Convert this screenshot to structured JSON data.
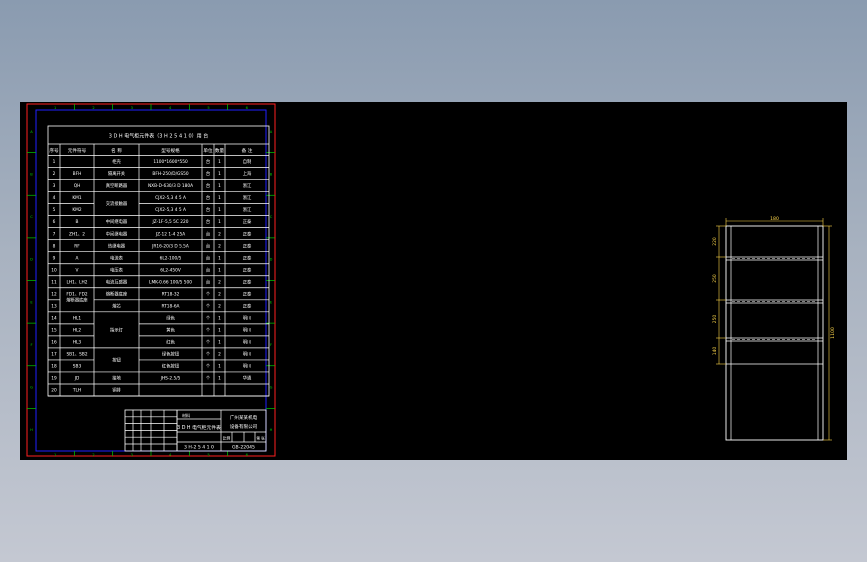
{
  "sheet": {
    "table_title": "3 D H 电气柜元件表（3 H 2 5 4 1 0）用 台",
    "headers": [
      "序号",
      "元件符号",
      "名  称",
      "型号规格",
      "单位",
      "数量",
      "备  注"
    ],
    "rows": [
      {
        "no": "1",
        "sym": "",
        "name": "柜壳",
        "spec": "1100*1600*550",
        "unit": "台",
        "qty": "1",
        "note": "自制"
      },
      {
        "no": "2",
        "sym": "BFH",
        "name": "隔离开关",
        "spec": "BFH-250/D/GS50",
        "unit": "台",
        "qty": "1",
        "note": "上海"
      },
      {
        "no": "3",
        "sym": "QH",
        "name": "真空断路器",
        "spec": "NXB-D-630/3 D 180A",
        "unit": "台",
        "qty": "1",
        "note": "浙江"
      },
      {
        "no": "4",
        "sym": "KM1",
        "name": "",
        "spec": "CJX2-5,3 4 5 A",
        "unit": "台",
        "qty": "1",
        "note": "浙江"
      },
      {
        "no": "5",
        "sym": "KM2",
        "name": "",
        "spec": "CJX2-5,3 4 5 A",
        "unit": "台",
        "qty": "1",
        "note": "浙江"
      },
      {
        "no": "6",
        "sym": "B",
        "name": "中间继电器",
        "spec": "JZ-1F-5,5 5C 220",
        "unit": "台",
        "qty": "1",
        "note": "正泰"
      },
      {
        "no": "7",
        "sym": "ZH1、2",
        "name": "中间继电器",
        "spec": "JZ-12 1-4  25A",
        "unit": "台",
        "qty": "2",
        "note": "正泰"
      },
      {
        "no": "8",
        "sym": "RF",
        "name": "热继电器",
        "spec": "JR16-20/3 D  5.5A",
        "unit": "台",
        "qty": "2",
        "note": "正泰"
      },
      {
        "no": "9",
        "sym": "A",
        "name": "电流表",
        "spec": "6L2-100/5",
        "unit": "台",
        "qty": "1",
        "note": "正泰"
      },
      {
        "no": "10",
        "sym": "V",
        "name": "电压表",
        "spec": "6L2-450V",
        "unit": "台",
        "qty": "1",
        "note": "正泰"
      },
      {
        "no": "11",
        "sym": "LH1、LH2",
        "name": "电流互感器",
        "spec": "LMK-0.66 100/5 500",
        "unit": "台",
        "qty": "2",
        "note": "正泰"
      },
      {
        "no": "12",
        "sym": "FD1、FD2",
        "name": "熔断器底座",
        "spec": "RT18-32",
        "unit": "个",
        "qty": "2",
        "note": "正泰"
      },
      {
        "no": "13",
        "sym": "",
        "name": "熔芯",
        "spec": "RT18-6A",
        "unit": "个",
        "qty": "2",
        "note": "正泰"
      },
      {
        "no": "14",
        "sym": "HL1",
        "name": "",
        "spec": "绿色",
        "unit": "个",
        "qty": "1",
        "note": "明川"
      },
      {
        "no": "15",
        "sym": "HL2",
        "name": "",
        "spec": "黄色",
        "unit": "个",
        "qty": "1",
        "note": "明川"
      },
      {
        "no": "16",
        "sym": "HL3",
        "name": "",
        "spec": "红色",
        "unit": "个",
        "qty": "1",
        "note": "明川"
      },
      {
        "no": "17",
        "sym": "SB1、SB2",
        "name": "",
        "spec": "绿色按钮",
        "unit": "个",
        "qty": "2",
        "note": "明川"
      },
      {
        "no": "18",
        "sym": "SB3",
        "name": "",
        "spec": "红色按钮",
        "unit": "个",
        "qty": "1",
        "note": "明川"
      },
      {
        "no": "19",
        "sym": "JD",
        "name": "接地",
        "spec": "JHS-2.5/5",
        "unit": "个",
        "qty": "1",
        "note": "华通"
      },
      {
        "no": "20",
        "sym": "TLH",
        "name": "铜排",
        "spec": "",
        "unit": "",
        "qty": "",
        "note": ""
      }
    ],
    "merged": [
      {
        "label": "交流接触器",
        "from": 4,
        "to": 5,
        "col": 2
      },
      {
        "label": "熔断器底座",
        "from": 12,
        "to": 13,
        "col": 1
      },
      {
        "label": "指示灯",
        "from": 14,
        "to": 16,
        "col": 2
      },
      {
        "label": "按钮",
        "from": 17,
        "to": 18,
        "col": 2
      }
    ],
    "title_block": {
      "company_1": "广州某某机电",
      "company_2": "设备有限公司",
      "drawing_name": "3 D H 电气柜元件表",
      "code": "3 H-2 5 4 1 0",
      "label_material": "材料",
      "drawing_no": "GB-22045",
      "scale_label": "比例",
      "sheet_label": "第 张"
    },
    "border_ticks_top": [
      "1",
      "2",
      "3",
      "4",
      "5",
      "6"
    ],
    "border_ticks_side": [
      "A",
      "B",
      "C",
      "D",
      "E",
      "F",
      "G",
      "H"
    ]
  },
  "elevation": {
    "overall_width": "180",
    "overall_height": "1100",
    "dims_left": [
      "220",
      "250",
      "250",
      "140"
    ]
  },
  "colors": {
    "background": "#000000",
    "lines": "#ffffff",
    "sheet_border": "#ff2020",
    "frame": "#2020ff",
    "ticks": "#00cc00",
    "dims": "#ffd84a"
  }
}
